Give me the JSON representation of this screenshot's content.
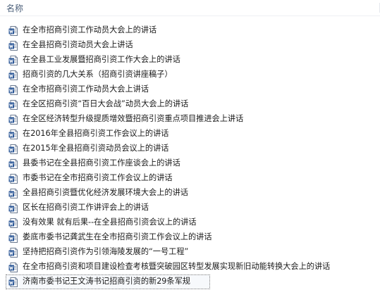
{
  "header": {
    "column_name": "名称"
  },
  "files": [
    {
      "name": "在全市招商引资工作动员大会上的讲话",
      "icon": "word-document-icon"
    },
    {
      "name": "在全县招商引资动员大会上讲话",
      "icon": "word-document-icon"
    },
    {
      "name": "在全县工业发展暨招商引资工作大会上的讲话",
      "icon": "word-document-icon"
    },
    {
      "name": "招商引资的几大关系（招商引资讲座稿子）",
      "icon": "word-document-icon"
    },
    {
      "name": "在全市招商引资工作动员大会上讲话",
      "icon": "word-document-icon"
    },
    {
      "name": "在全区招商引资“百日大会战”动员大会上的讲话",
      "icon": "word-document-icon"
    },
    {
      "name": "在全区经济转型升级提质增效暨招商引资重点项目推进会上讲话",
      "icon": "word-document-icon"
    },
    {
      "name": "在2016年全县招商引资工作会议上的讲话",
      "icon": "word-document-icon"
    },
    {
      "name": "在2015年全县招商引资动员会议上的讲话",
      "icon": "word-document-icon"
    },
    {
      "name": "县委书记在全县招商引资工作座谈会上的讲话",
      "icon": "word-document-icon"
    },
    {
      "name": "市委书记在全市招商引资工作会议上的讲话",
      "icon": "word-document-icon"
    },
    {
      "name": "全县招商引资暨优化经济发展环境大会上的讲话",
      "icon": "word-document-icon"
    },
    {
      "name": "区长在招商引资工作讲评会上的讲话",
      "icon": "word-document-icon"
    },
    {
      "name": "没有效果 就有后果--在全县招商引资会议上的讲话",
      "icon": "word-document-icon"
    },
    {
      "name": "娄底市委书记龚武生在全市招商引资工作会议上的讲话",
      "icon": "word-document-icon"
    },
    {
      "name": "坚持把招商引资作为引领海陵发展的“一号工程”",
      "icon": "word-document-icon"
    },
    {
      "name": "在全市招商引资和项目建设检查考核暨突破园区转型发展实现新旧动能转换大会上的讲话",
      "icon": "word-document-icon"
    },
    {
      "name": "济南市委书记王文涛书记招商引资的新29条军规",
      "icon": "word-document-icon",
      "selected": true
    }
  ],
  "colors": {
    "header_text": "#4c607a",
    "icon_blue": "#2b5797",
    "selection_border": "#7a7a7a"
  }
}
